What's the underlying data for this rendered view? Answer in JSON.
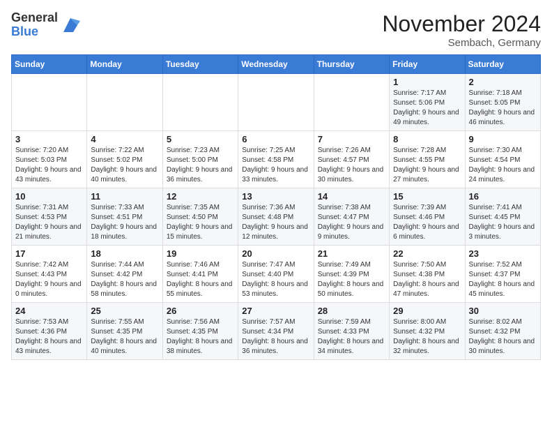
{
  "logo": {
    "general": "General",
    "blue": "Blue"
  },
  "title": "November 2024",
  "location": "Sembach, Germany",
  "days_of_week": [
    "Sunday",
    "Monday",
    "Tuesday",
    "Wednesday",
    "Thursday",
    "Friday",
    "Saturday"
  ],
  "weeks": [
    [
      {
        "day": "",
        "info": ""
      },
      {
        "day": "",
        "info": ""
      },
      {
        "day": "",
        "info": ""
      },
      {
        "day": "",
        "info": ""
      },
      {
        "day": "",
        "info": ""
      },
      {
        "day": "1",
        "info": "Sunrise: 7:17 AM\nSunset: 5:06 PM\nDaylight: 9 hours and 49 minutes."
      },
      {
        "day": "2",
        "info": "Sunrise: 7:18 AM\nSunset: 5:05 PM\nDaylight: 9 hours and 46 minutes."
      }
    ],
    [
      {
        "day": "3",
        "info": "Sunrise: 7:20 AM\nSunset: 5:03 PM\nDaylight: 9 hours and 43 minutes."
      },
      {
        "day": "4",
        "info": "Sunrise: 7:22 AM\nSunset: 5:02 PM\nDaylight: 9 hours and 40 minutes."
      },
      {
        "day": "5",
        "info": "Sunrise: 7:23 AM\nSunset: 5:00 PM\nDaylight: 9 hours and 36 minutes."
      },
      {
        "day": "6",
        "info": "Sunrise: 7:25 AM\nSunset: 4:58 PM\nDaylight: 9 hours and 33 minutes."
      },
      {
        "day": "7",
        "info": "Sunrise: 7:26 AM\nSunset: 4:57 PM\nDaylight: 9 hours and 30 minutes."
      },
      {
        "day": "8",
        "info": "Sunrise: 7:28 AM\nSunset: 4:55 PM\nDaylight: 9 hours and 27 minutes."
      },
      {
        "day": "9",
        "info": "Sunrise: 7:30 AM\nSunset: 4:54 PM\nDaylight: 9 hours and 24 minutes."
      }
    ],
    [
      {
        "day": "10",
        "info": "Sunrise: 7:31 AM\nSunset: 4:53 PM\nDaylight: 9 hours and 21 minutes."
      },
      {
        "day": "11",
        "info": "Sunrise: 7:33 AM\nSunset: 4:51 PM\nDaylight: 9 hours and 18 minutes."
      },
      {
        "day": "12",
        "info": "Sunrise: 7:35 AM\nSunset: 4:50 PM\nDaylight: 9 hours and 15 minutes."
      },
      {
        "day": "13",
        "info": "Sunrise: 7:36 AM\nSunset: 4:48 PM\nDaylight: 9 hours and 12 minutes."
      },
      {
        "day": "14",
        "info": "Sunrise: 7:38 AM\nSunset: 4:47 PM\nDaylight: 9 hours and 9 minutes."
      },
      {
        "day": "15",
        "info": "Sunrise: 7:39 AM\nSunset: 4:46 PM\nDaylight: 9 hours and 6 minutes."
      },
      {
        "day": "16",
        "info": "Sunrise: 7:41 AM\nSunset: 4:45 PM\nDaylight: 9 hours and 3 minutes."
      }
    ],
    [
      {
        "day": "17",
        "info": "Sunrise: 7:42 AM\nSunset: 4:43 PM\nDaylight: 9 hours and 0 minutes."
      },
      {
        "day": "18",
        "info": "Sunrise: 7:44 AM\nSunset: 4:42 PM\nDaylight: 8 hours and 58 minutes."
      },
      {
        "day": "19",
        "info": "Sunrise: 7:46 AM\nSunset: 4:41 PM\nDaylight: 8 hours and 55 minutes."
      },
      {
        "day": "20",
        "info": "Sunrise: 7:47 AM\nSunset: 4:40 PM\nDaylight: 8 hours and 53 minutes."
      },
      {
        "day": "21",
        "info": "Sunrise: 7:49 AM\nSunset: 4:39 PM\nDaylight: 8 hours and 50 minutes."
      },
      {
        "day": "22",
        "info": "Sunrise: 7:50 AM\nSunset: 4:38 PM\nDaylight: 8 hours and 47 minutes."
      },
      {
        "day": "23",
        "info": "Sunrise: 7:52 AM\nSunset: 4:37 PM\nDaylight: 8 hours and 45 minutes."
      }
    ],
    [
      {
        "day": "24",
        "info": "Sunrise: 7:53 AM\nSunset: 4:36 PM\nDaylight: 8 hours and 43 minutes."
      },
      {
        "day": "25",
        "info": "Sunrise: 7:55 AM\nSunset: 4:35 PM\nDaylight: 8 hours and 40 minutes."
      },
      {
        "day": "26",
        "info": "Sunrise: 7:56 AM\nSunset: 4:35 PM\nDaylight: 8 hours and 38 minutes."
      },
      {
        "day": "27",
        "info": "Sunrise: 7:57 AM\nSunset: 4:34 PM\nDaylight: 8 hours and 36 minutes."
      },
      {
        "day": "28",
        "info": "Sunrise: 7:59 AM\nSunset: 4:33 PM\nDaylight: 8 hours and 34 minutes."
      },
      {
        "day": "29",
        "info": "Sunrise: 8:00 AM\nSunset: 4:32 PM\nDaylight: 8 hours and 32 minutes."
      },
      {
        "day": "30",
        "info": "Sunrise: 8:02 AM\nSunset: 4:32 PM\nDaylight: 8 hours and 30 minutes."
      }
    ]
  ]
}
